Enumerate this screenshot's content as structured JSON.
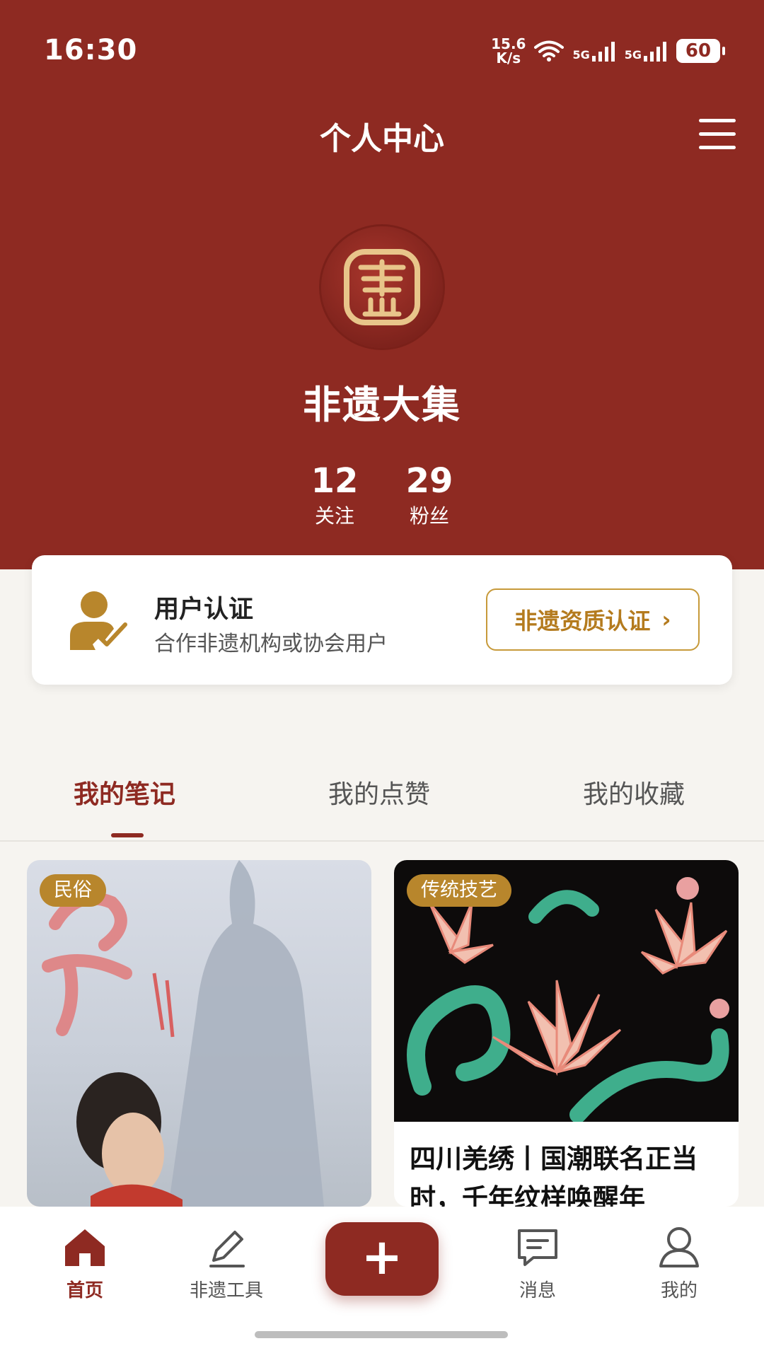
{
  "status_bar": {
    "time": "16:30",
    "net_speed_value": "15.6",
    "net_speed_unit": "K/s",
    "signal_1": "5G",
    "signal_2": "5G",
    "battery": "60"
  },
  "header": {
    "title": "个人中心",
    "menu_icon": "hamburger-menu-icon"
  },
  "profile": {
    "username": "非遗大集",
    "stats": [
      {
        "value": "12",
        "label": "关注"
      },
      {
        "value": "29",
        "label": "粉丝"
      }
    ]
  },
  "certification": {
    "title": "用户认证",
    "description": "合作非遗机构或协会用户",
    "button_label": "非遗资质认证",
    "button_arrow": "›"
  },
  "tabs": [
    {
      "label": "我的笔记",
      "active": true
    },
    {
      "label": "我的点赞",
      "active": false
    },
    {
      "label": "我的收藏",
      "active": false
    }
  ],
  "cards": [
    {
      "tag": "民俗",
      "caption": ""
    },
    {
      "tag": "传统技艺",
      "caption": "四川羌绣丨国潮联名正当时，千年纹样唤醒年"
    }
  ],
  "bottom_nav": [
    {
      "label": "首页",
      "icon": "home-icon",
      "active": true
    },
    {
      "label": "非遗工具",
      "icon": "pencil-icon",
      "active": false
    },
    {
      "label": "",
      "icon": "add-icon",
      "active": false
    },
    {
      "label": "消息",
      "icon": "message-icon",
      "active": false
    },
    {
      "label": "我的",
      "icon": "user-icon",
      "active": false
    }
  ],
  "colors": {
    "primary": "#8e2a22",
    "gold": "#b8862c",
    "background": "#f6f4f0"
  }
}
